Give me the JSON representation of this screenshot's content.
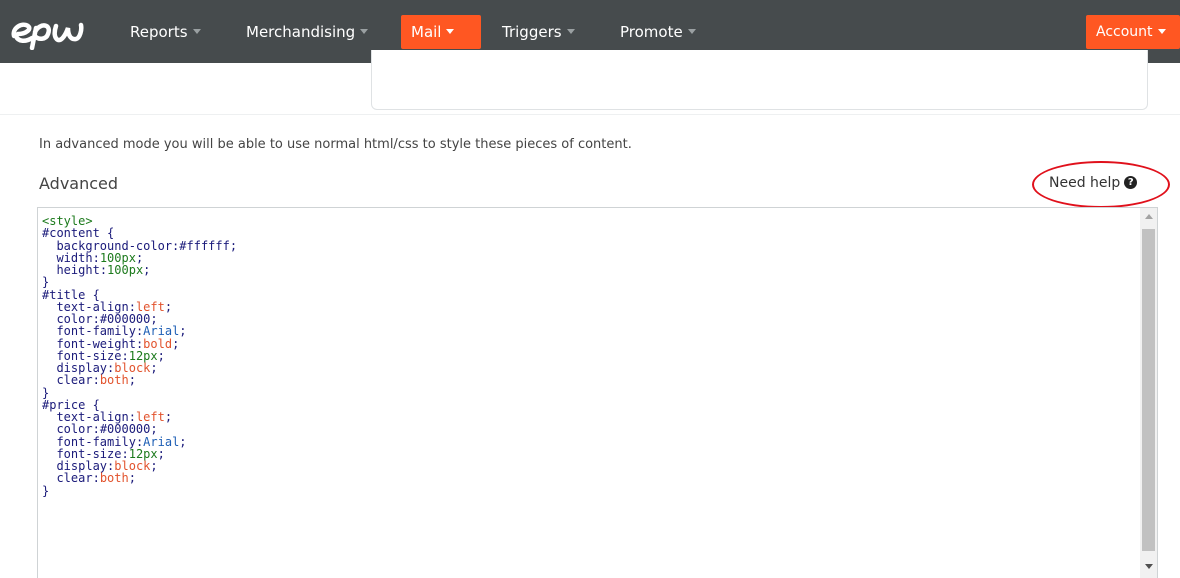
{
  "nav": {
    "logo_icon": "epi-logo",
    "items": [
      {
        "label": "Reports",
        "active": false
      },
      {
        "label": "Merchandising",
        "active": false
      },
      {
        "label": "Mail",
        "active": true
      },
      {
        "label": "Triggers",
        "active": false
      },
      {
        "label": "Promote",
        "active": false
      }
    ],
    "account_label": "Account"
  },
  "content": {
    "intro": "In advanced mode you will be able to use normal html/css to style these pieces of content.",
    "section_label": "Advanced",
    "help_label": "Need help",
    "help_icon": "question-circle-icon",
    "code_lines": [
      "<style>",
      "#content {",
      "  background-color:#ffffff;",
      "  width:100px;",
      "  height:100px;",
      "}",
      "#title {",
      "  text-align:left;",
      "  color:#000000;",
      "  font-family:Arial;",
      "  font-weight:bold;",
      "  font-size:12px;",
      "  display:block;",
      "  clear:both;",
      "}",
      "#price {",
      "  text-align:left;",
      "  color:#000000;",
      "  font-family:Arial;",
      "  font-size:12px;",
      "  display:block;",
      "  clear:both;",
      "}"
    ]
  },
  "colors": {
    "navbar": "#464b4d",
    "accent": "#ff5722",
    "annotation": "#e0101b"
  }
}
